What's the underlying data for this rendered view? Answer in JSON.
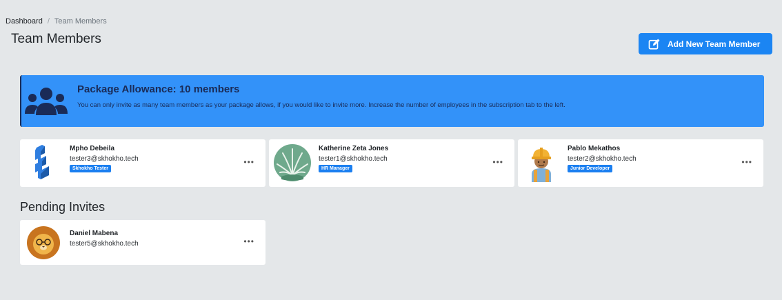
{
  "breadcrumb": {
    "home": "Dashboard",
    "separator": "/",
    "current": "Team Members"
  },
  "page_title": "Team Members",
  "add_button": {
    "label": "Add New Team Member",
    "icon": "edit-icon"
  },
  "alert": {
    "title": "Package Allowance: 10 members",
    "text": "You can only invite as many team members as your package allows, if you would like to invite more. Increase the number of employees in the subscription tab to the left.",
    "icon": "users-group-icon"
  },
  "members": [
    {
      "name": "Mpho Debeila",
      "email": "tester3@skhokho.tech",
      "role": "Skhokho Tester",
      "avatar": "blue-staircase-avatar"
    },
    {
      "name": "Katherine Zeta Jones",
      "email": "tester1@skhokho.tech",
      "role": "HR Manager",
      "avatar": "aloe-plant-avatar"
    },
    {
      "name": "Pablo Mekathos",
      "email": "tester2@skhokho.tech",
      "role": "Junior Developer",
      "avatar": "construction-worker-avatar"
    }
  ],
  "pending_title": "Pending Invites",
  "pending": [
    {
      "name": "Daniel Mabena",
      "email": "tester5@skhokho.tech",
      "avatar": "lion-avatar"
    }
  ],
  "more_label": "•••",
  "colors": {
    "primary": "#1b85f3",
    "alert_bg": "#3392f9",
    "alert_text": "#1a2b57",
    "page_bg": "#e4e7e9"
  }
}
